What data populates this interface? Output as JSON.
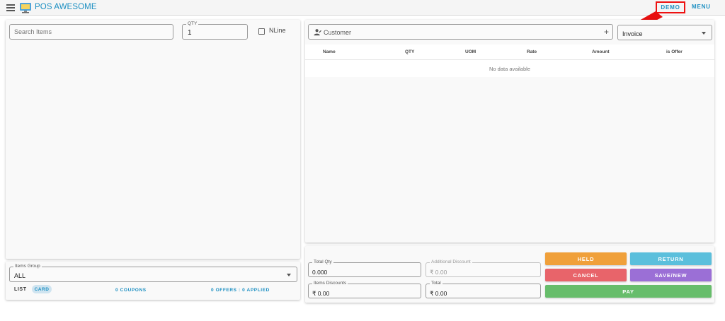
{
  "header": {
    "app_title_prefix": "POS ",
    "app_title_bold": "AWESOME",
    "demo_label": "DEMO",
    "menu_label": "MENU",
    "accent_color": "#1c8fc2"
  },
  "items_panel": {
    "search_placeholder": "Search Items",
    "qty_label": "QTY",
    "qty_value": "1",
    "nline_label": "NLine",
    "nline_checked": false
  },
  "items_group": {
    "label": "Items Group",
    "value": "ALL",
    "tab_list": "LIST",
    "tab_card": "CARD",
    "coupons": "0 COUPONS",
    "offers": "0 OFFERS : 0 APPLIED"
  },
  "invoice_panel": {
    "customer_placeholder": "Customer",
    "invoice_type": "Invoice",
    "columns": [
      "Name",
      "QTY",
      "UOM",
      "Rate",
      "Amount",
      "is Offer"
    ],
    "empty_text": "No data available"
  },
  "totals": {
    "total_qty_label": "Total Qty",
    "total_qty_value": "0.000",
    "additional_discount_label": "Additional Discount",
    "additional_discount_value": "₹ 0.00",
    "items_discounts_label": "Items Discounts",
    "items_discounts_value": "₹ 0.00",
    "total_label": "Total",
    "total_value": "₹ 0.00"
  },
  "actions": {
    "held": "HELD",
    "return": "RETURN",
    "cancel": "CANCEL",
    "save_new": "SAVE/NEW",
    "pay": "PAY",
    "colors": {
      "held": "#f0a03a",
      "return": "#5bbfdc",
      "cancel": "#e8646a",
      "save_new": "#9b6fd6",
      "pay": "#67bd6b"
    }
  }
}
